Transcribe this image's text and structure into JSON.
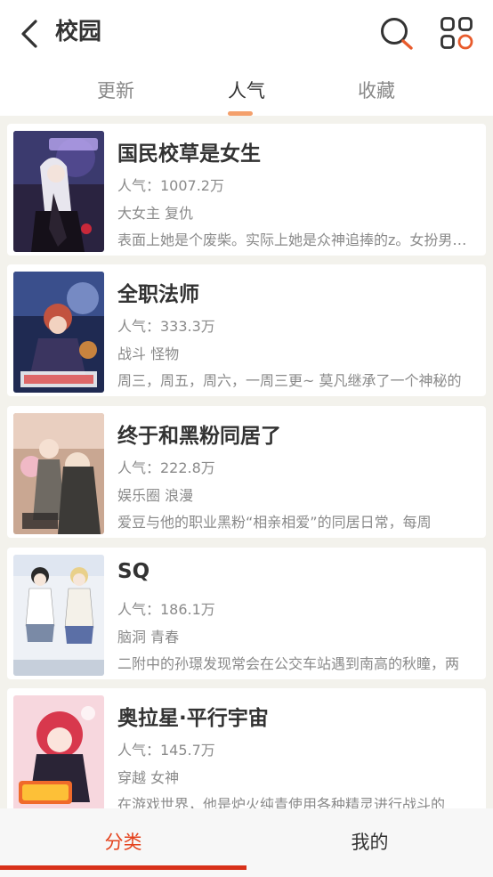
{
  "header": {
    "title": "校园",
    "back_icon": "chevron-left-icon",
    "search_icon": "search-icon",
    "grid_icon": "category-grid-icon"
  },
  "tabs": [
    {
      "label": "更新"
    },
    {
      "label": "人气"
    },
    {
      "label": "收藏"
    }
  ],
  "active_tab": "人气",
  "items": [
    {
      "title": "国民校草是女生",
      "popularity": "人气：1007.2万",
      "tags": "大女主 复仇",
      "desc": "表面上她是个废柴。实际上她是众神追捧的z。女扮男装，回国"
    },
    {
      "title": "全职法师",
      "popularity": "人气：333.3万",
      "tags": "战斗 怪物",
      "desc": "周三，周五，周六，一周三更~ 莫凡继承了一个神秘的"
    },
    {
      "title": "终于和黑粉同居了",
      "popularity": "人气：222.8万",
      "tags": "娱乐圈 浪漫",
      "desc": "爱豆与他的职业黑粉“相亲相爱”的同居日常，每周"
    },
    {
      "title": "SQ",
      "popularity": "人气：186.1万",
      "tags": "脑洞 青春",
      "desc": "二附中的孙璟发现常会在公交车站遇到南高的秋瞳，两"
    },
    {
      "title": "奥拉星·平行宇宙",
      "popularity": "人气：145.7万",
      "tags": "穿越 女神",
      "desc": "在游戏世界，他是炉火纯青使用各种精灵进行战斗的"
    }
  ],
  "bottom_nav": [
    {
      "label": "分类"
    },
    {
      "label": "我的"
    }
  ],
  "colors": {
    "accent": "#e4421d",
    "tab_indicator": "#f4a06c",
    "background": "#f3f2ec"
  }
}
